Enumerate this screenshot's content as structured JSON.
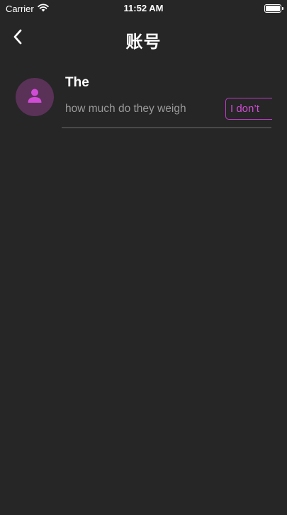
{
  "status_bar": {
    "carrier": "Carrier",
    "time": "11:52 AM",
    "wifi_icon": "wifi-icon",
    "battery_icon": "battery-icon",
    "battery_level": 1.0
  },
  "nav": {
    "title": "账号",
    "back_icon": "chevron-left-icon"
  },
  "list": {
    "items": [
      {
        "title": "The",
        "subtitle": "how much do they weigh",
        "tag_label": "I don’t",
        "avatar_icon": "person-icon"
      }
    ]
  },
  "colors": {
    "background": "#262626",
    "accent": "#d14cd6",
    "avatar_bg": "#5a3157",
    "subtitle_text": "#9a9a9a"
  }
}
